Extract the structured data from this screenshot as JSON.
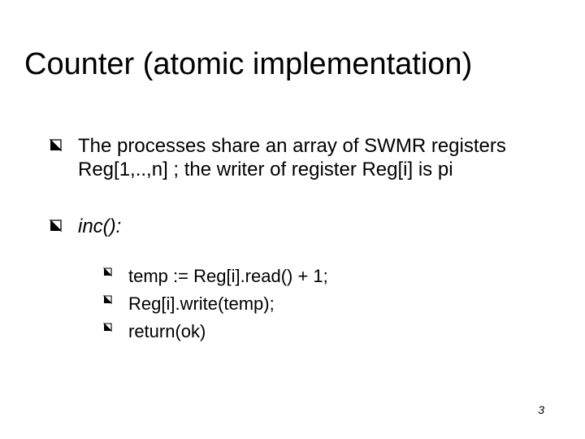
{
  "slide": {
    "title": "Counter (atomic implementation)",
    "bullets": {
      "p1": "The processes share an array of SWMR registers Reg[1,..,n] ; the writer of register Reg[i] is pi",
      "p2": "inc():",
      "sub1": "temp := Reg[i].read() + 1;",
      "sub2": "Reg[i].write(temp);",
      "sub3": "return(ok)"
    },
    "page_number": "3"
  }
}
